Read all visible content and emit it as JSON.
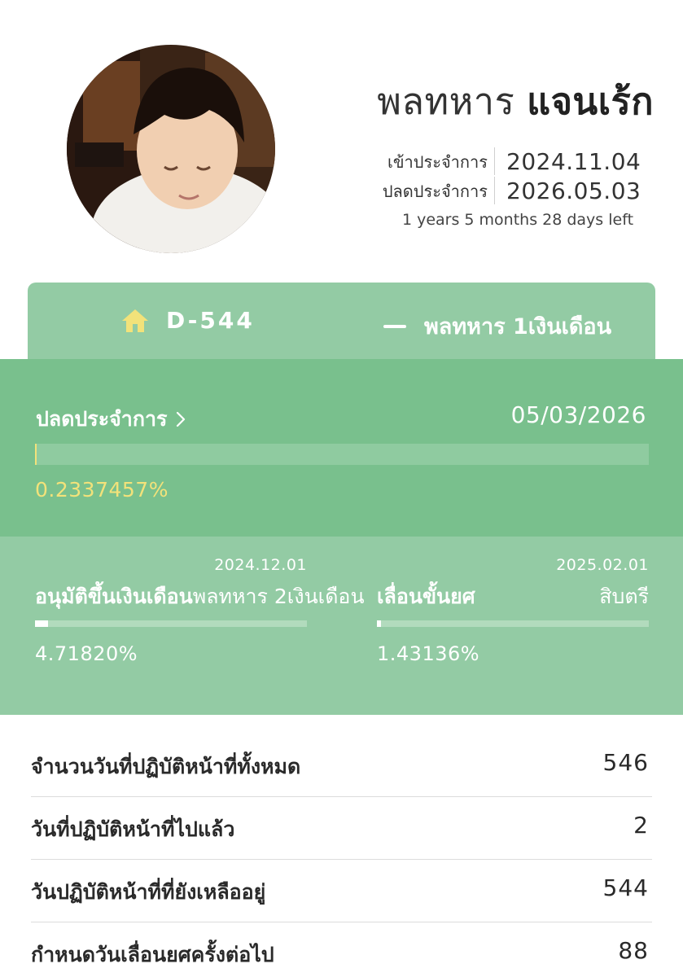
{
  "profile": {
    "rank_name": "พลทหาร",
    "last_name": "แจนเร้ก",
    "enlist_label": "เข้าประจำการ",
    "enlist_date": "2024.11.04",
    "discharge_label": "ปลดประจำการ",
    "discharge_date": "2026.05.03",
    "time_left": "1 years 5 months 28 days left"
  },
  "info_card": {
    "dday": "D-544",
    "dday_icon": "house-icon",
    "rank_icon": "dash-icon",
    "rank_label": "พลทหาร 1เงินเดือน"
  },
  "discharge_progress": {
    "title": "ปลดประจำการ",
    "date": "05/03/2026",
    "percent_label": "0.2337457%",
    "percent_value": 0.2337457
  },
  "sub_progress": [
    {
      "date": "2024.12.01",
      "title": "อนุมัติขึ้นเงินเดือน",
      "title_suffix": "พลทหาร 2เงินเดือน",
      "percent_label": "4.71820%",
      "percent_value": 4.7182
    },
    {
      "date": "2025.02.01",
      "title": "เลื่อนขั้นยศ",
      "right_label": "สิบตรี",
      "percent_label": "1.43136%",
      "percent_value": 1.43136
    }
  ],
  "stats": [
    {
      "label": "จำนวนวันที่ปฏิบัติหน้าที่ทั้งหมด",
      "value": "546"
    },
    {
      "label": "วันที่ปฏิบัติหน้าที่ไปแล้ว",
      "value": "2"
    },
    {
      "label": "วันปฏิบัติหน้าที่ที่ยังเหลืออยู่",
      "value": "544"
    },
    {
      "label": "กำหนดวันเลื่อนยศครั้งต่อไป",
      "value": "88"
    }
  ],
  "colors": {
    "card_light_green": "#93cba4",
    "card_mid_green": "#79c08d",
    "accent_yellow": "#f2e27a"
  }
}
